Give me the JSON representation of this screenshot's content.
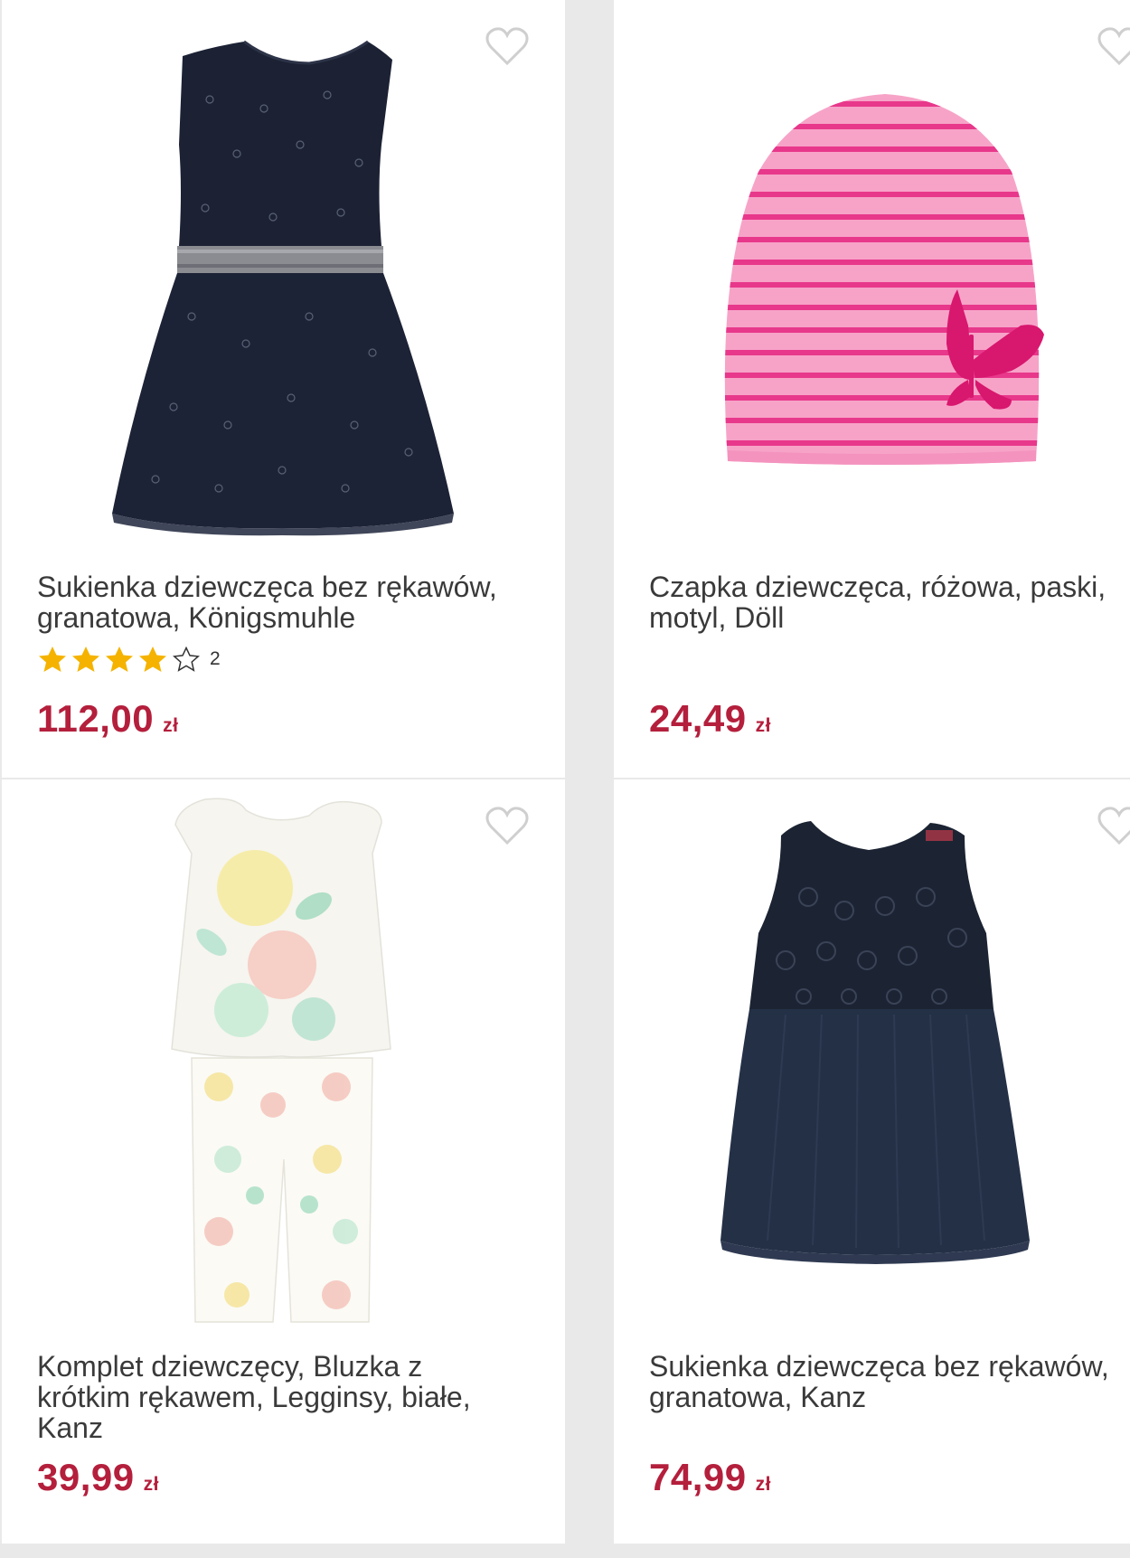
{
  "products": [
    {
      "title": "Sukienka dziewczęca bez rękawów,\ngranatowa, Königsmuhle",
      "rating": 4,
      "rating_max": 5,
      "review_count": "2",
      "price": "112,00",
      "currency": "zł",
      "image_icon": "navy-dress-image"
    },
    {
      "title": "Czapka dziewczęca, różowa, paski,\nmotyl, Döll",
      "price": "24,49",
      "currency": "zł",
      "image_icon": "pink-striped-hat-image"
    },
    {
      "title": "Komplet dziewczęcy, Bluzka z\nkrótkim rękawem, Legginsy, białe,\nKanz",
      "price": "39,99",
      "currency": "zł",
      "image_icon": "floral-set-image"
    },
    {
      "title": "Sukienka dziewczęca bez rękawów,\ngranatowa, Kanz",
      "price": "74,99",
      "currency": "zł",
      "image_icon": "navy-lace-dress-image"
    }
  ],
  "colors": {
    "price": "#b41f3c",
    "star": "#f5b300",
    "heart_outline": "#cfcfcf",
    "background": "#e9e9e9"
  }
}
